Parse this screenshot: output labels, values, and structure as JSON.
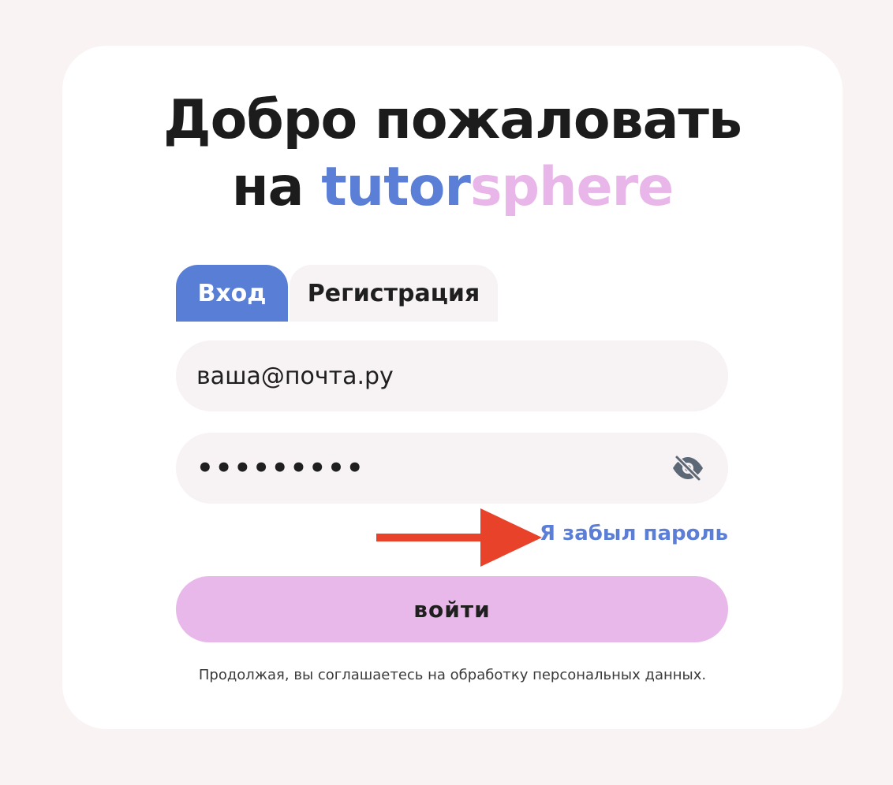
{
  "header": {
    "title_line1": "Добро пожаловать",
    "title_line2_prefix": "на",
    "brand_part1": "tutor",
    "brand_part2": "sphere"
  },
  "tabs": [
    {
      "label": "Вход",
      "active": true
    },
    {
      "label": "Регистрация",
      "active": false
    }
  ],
  "form": {
    "email_value": "ваша@почта.ру",
    "password_value": "•••••••••",
    "password_toggle_icon": "eye-slash-icon",
    "forgot_label": "Я забыл пароль",
    "submit_label": "войти",
    "consent_text": "Продолжая, вы соглашаетесь на обработку персональных данных."
  },
  "annotation": {
    "arrow_icon": "arrow-right-icon",
    "arrow_color": "#e8432a"
  },
  "colors": {
    "background": "#f9f3f4",
    "card": "#ffffff",
    "accent_blue": "#597ed6",
    "accent_pink": "#e8b8ea",
    "field_bg": "#f7f2f3"
  }
}
